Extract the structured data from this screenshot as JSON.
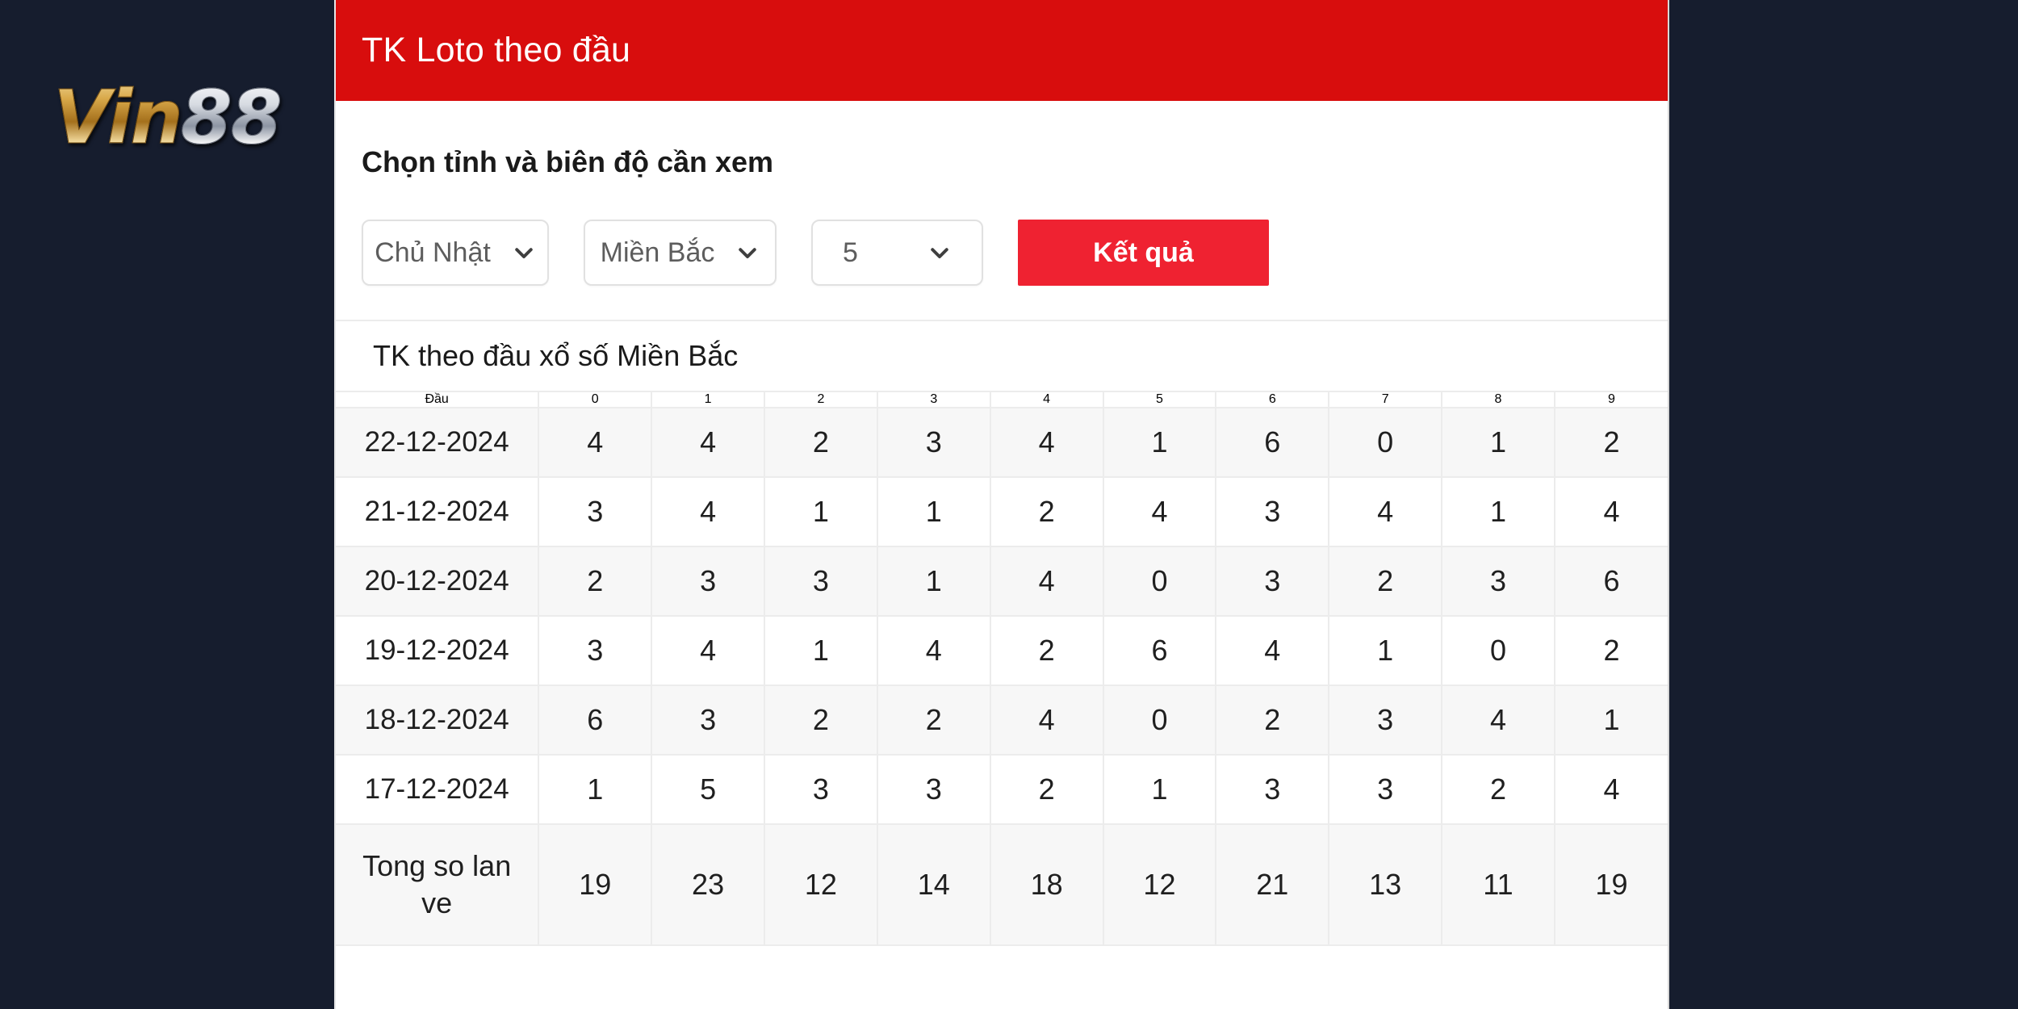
{
  "brand": {
    "name_gold": "Vin",
    "name_silver": "88"
  },
  "header": {
    "title": "TK Loto theo đầu"
  },
  "panel": {
    "label": "Chọn tỉnh và biên độ cần xem",
    "selects": [
      {
        "name": "day",
        "value": "Chủ Nhật"
      },
      {
        "name": "region",
        "value": "Miền Bắc"
      },
      {
        "name": "count",
        "value": "5"
      }
    ],
    "result_button": "Kết quả"
  },
  "table": {
    "caption": "TK theo đầu xổ số Miền Bắc",
    "head_label": "Đầu",
    "columns": [
      "0",
      "1",
      "2",
      "3",
      "4",
      "5",
      "6",
      "7",
      "8",
      "9"
    ],
    "rows": [
      {
        "date": "22-12-2024",
        "values": [
          "4",
          "4",
          "2",
          "3",
          "4",
          "1",
          "6",
          "0",
          "1",
          "2"
        ]
      },
      {
        "date": "21-12-2024",
        "values": [
          "3",
          "4",
          "1",
          "1",
          "2",
          "4",
          "3",
          "4",
          "1",
          "4"
        ]
      },
      {
        "date": "20-12-2024",
        "values": [
          "2",
          "3",
          "3",
          "1",
          "4",
          "0",
          "3",
          "2",
          "3",
          "6"
        ]
      },
      {
        "date": "19-12-2024",
        "values": [
          "3",
          "4",
          "1",
          "4",
          "2",
          "6",
          "4",
          "1",
          "0",
          "2"
        ]
      },
      {
        "date": "18-12-2024",
        "values": [
          "6",
          "3",
          "2",
          "2",
          "4",
          "0",
          "2",
          "3",
          "4",
          "1"
        ]
      },
      {
        "date": "17-12-2024",
        "values": [
          "1",
          "5",
          "3",
          "3",
          "2",
          "1",
          "3",
          "3",
          "2",
          "4"
        ]
      }
    ],
    "total_label": "Tong so lan ve",
    "totals": [
      "19",
      "23",
      "12",
      "14",
      "18",
      "12",
      "21",
      "13",
      "11",
      "19"
    ]
  },
  "colors": {
    "page_background": "#161d2e",
    "header_red": "#d80d0d",
    "button_red": "#ef2231",
    "head_label_red": "#ff1b1b",
    "head_number_blue": "#1414ff",
    "row_alt": "#f7f7f7",
    "border": "#ececec"
  }
}
